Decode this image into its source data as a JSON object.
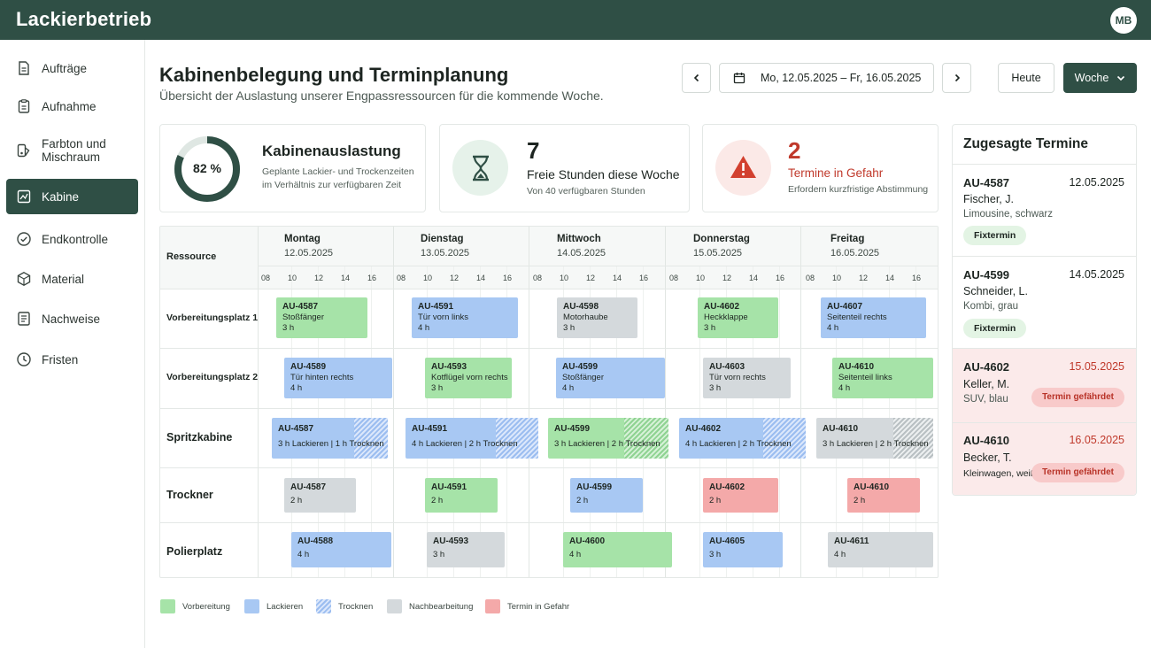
{
  "app": {
    "title": "Lackierbetrieb",
    "user_initials": "MB"
  },
  "sidebar": {
    "items": [
      {
        "label": "Aufträge",
        "icon": "document-icon",
        "active": false
      },
      {
        "label": "Aufnahme",
        "icon": "clipboard-icon",
        "active": false
      },
      {
        "label": "Farbton und Mischraum",
        "icon": "color-swatch-icon",
        "active": false
      },
      {
        "label": "Kabine",
        "icon": "booth-icon",
        "active": true
      },
      {
        "label": "Endkontrolle",
        "icon": "check-circle-icon",
        "active": false
      },
      {
        "label": "Material",
        "icon": "box-icon",
        "active": false
      },
      {
        "label": "Nachweise",
        "icon": "list-document-icon",
        "active": false
      },
      {
        "label": "Fristen",
        "icon": "clock-icon",
        "active": false
      }
    ]
  },
  "header": {
    "title": "Kabinenbelegung und Terminplanung",
    "subtitle": "Übersicht der Auslastung unserer Engpassressourcen für die kommende Woche.",
    "date_range": "Mo, 12.05.2025 – Fr, 16.05.2025",
    "today_label": "Heute",
    "view_label": "Woche"
  },
  "stats": {
    "utilization": {
      "percent": 82,
      "display": "82 %",
      "title": "Kabinenauslastung",
      "desc": "Geplante Lackier- und Trockenzeiten im Verhältnis zur verfügbaren Zeit"
    },
    "free_hours": {
      "value": "7",
      "title": "Freie Stunden diese Woche",
      "desc": "Von 40 verfügbaren Stunden"
    },
    "at_risk": {
      "value": "2",
      "title": "Termine in Gefahr",
      "desc": "Erfordern kurzfristige Abstimmung"
    }
  },
  "schedule": {
    "resource_header": "Ressource",
    "days": [
      {
        "name": "Montag",
        "date": "12.05.2025"
      },
      {
        "name": "Dienstag",
        "date": "13.05.2025"
      },
      {
        "name": "Mittwoch",
        "date": "14.05.2025"
      },
      {
        "name": "Donnerstag",
        "date": "15.05.2025"
      },
      {
        "name": "Freitag",
        "date": "16.05.2025"
      }
    ],
    "hours": [
      "08",
      "10",
      "12",
      "14",
      "16"
    ],
    "resources": [
      "Vorbereitungsplatz 1",
      "Vorbereitungsplatz 2",
      "Spritzkabine",
      "Trockner",
      "Polierplatz"
    ],
    "blocks": {
      "r0": [
        {
          "id": "AU-4587",
          "detail": "Stoßfänger",
          "duration": "3 h"
        },
        {
          "id": "AU-4591",
          "detail": "Tür vorn links",
          "duration": "4 h"
        },
        {
          "id": "AU-4598",
          "detail": "Motorhaube",
          "duration": "3 h"
        },
        {
          "id": "AU-4602",
          "detail": "Heckklappe",
          "duration": "3 h"
        },
        {
          "id": "AU-4607",
          "detail": "Seitenteil rechts",
          "duration": "4 h"
        }
      ],
      "r1": [
        {
          "id": "AU-4589",
          "detail": "Tür hinten rechts",
          "duration": "4 h"
        },
        {
          "id": "AU-4593",
          "detail": "Kotflügel vorn rechts",
          "duration": "3 h"
        },
        {
          "id": "AU-4599",
          "detail": "Stoßfänger",
          "duration": "4 h"
        },
        {
          "id": "AU-4603",
          "detail": "Tür vorn rechts",
          "duration": "3 h"
        },
        {
          "id": "AU-4610",
          "detail": "Seitenteil links",
          "duration": "4 h"
        }
      ],
      "r2": [
        {
          "id": "AU-4587",
          "detail": "3 h Lackieren | 1 h Trocknen"
        },
        {
          "id": "AU-4591",
          "detail": "4 h Lackieren | 2 h Trocknen"
        },
        {
          "id": "AU-4599",
          "detail": "3 h Lackieren | 2 h Trocknen"
        },
        {
          "id": "AU-4602",
          "detail": "4 h Lackieren | 2 h Trocknen"
        },
        {
          "id": "AU-4610",
          "detail": "3 h Lackieren | 2 h Trocknen"
        }
      ],
      "r3": [
        {
          "id": "AU-4587",
          "duration": "2 h"
        },
        {
          "id": "AU-4591",
          "duration": "2 h"
        },
        {
          "id": "AU-4599",
          "duration": "2 h"
        },
        {
          "id": "AU-4602",
          "duration": "2 h"
        },
        {
          "id": "AU-4610",
          "duration": "2 h"
        }
      ],
      "r4": [
        {
          "id": "AU-4588",
          "duration": "4 h"
        },
        {
          "id": "AU-4593",
          "duration": "3 h"
        },
        {
          "id": "AU-4600",
          "duration": "4 h"
        },
        {
          "id": "AU-4605",
          "duration": "3 h"
        },
        {
          "id": "AU-4611",
          "duration": "4 h"
        }
      ]
    }
  },
  "appointments": {
    "title": "Zugesagte Termine",
    "items": [
      {
        "id": "AU-4587",
        "date": "12.05.2025",
        "customer": "Fischer, J.",
        "vehicle": "Limousine, schwarz",
        "status": "Fixtermin"
      },
      {
        "id": "AU-4599",
        "date": "14.05.2025",
        "customer": "Schneider, L.",
        "vehicle": "Kombi, grau",
        "status": "Fixtermin"
      },
      {
        "id": "AU-4602",
        "date": "15.05.2025",
        "customer": "Keller, M.",
        "vehicle": "SUV, blau",
        "status": "Termin gefährdet"
      },
      {
        "id": "AU-4610",
        "date": "16.05.2025",
        "customer": "Becker, T.",
        "vehicle": "Kleinwagen, weiß",
        "status": "Termin gefährdet"
      }
    ]
  },
  "legend": [
    "Vorbereitung",
    "Lackieren",
    "Trocknen",
    "Nachbearbeitung",
    "Termin in Gefahr"
  ],
  "colors": {
    "brand": "#2f4f45",
    "prep": "#a6e3a8",
    "paint": "#a8c8f3",
    "rework": "#d4d9dc",
    "risk": "#f4a9a9",
    "alert": "#c0392b"
  }
}
